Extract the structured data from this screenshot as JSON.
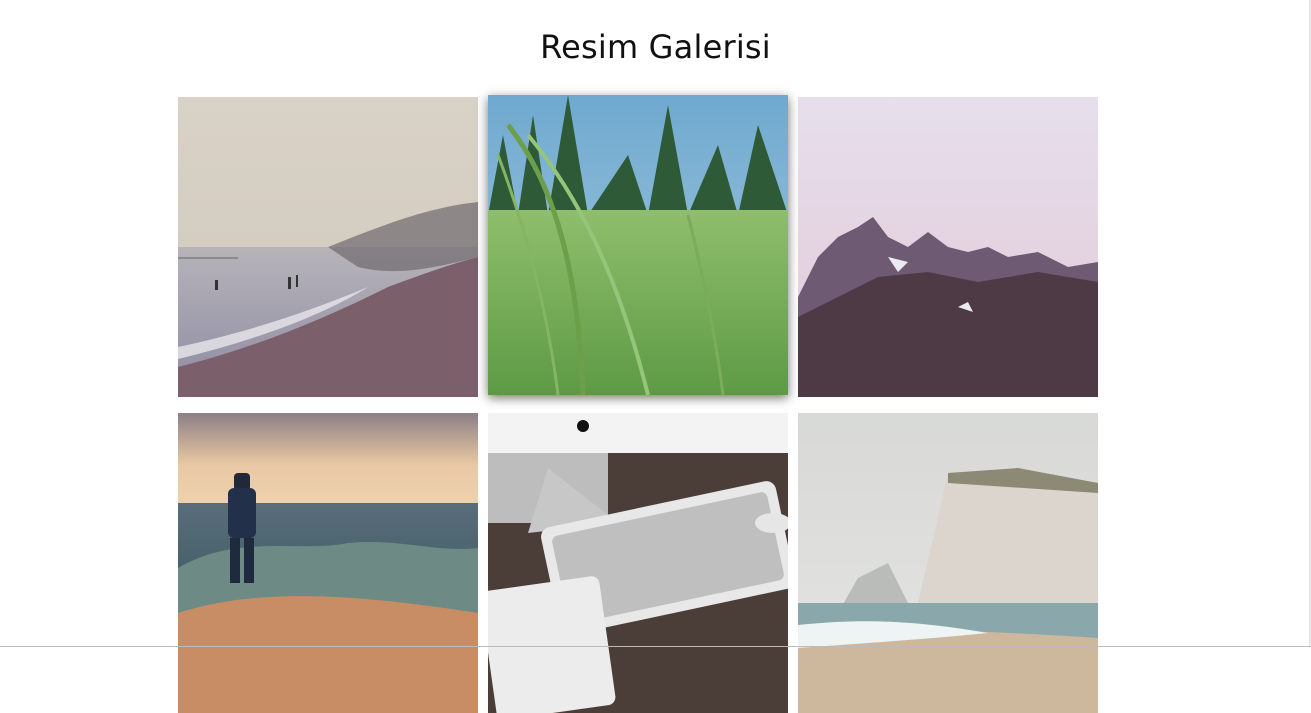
{
  "gallery": {
    "title": "Resim Galerisi",
    "images": [
      {
        "subject": "beach-fog"
      },
      {
        "subject": "grass-field"
      },
      {
        "subject": "mountains"
      },
      {
        "subject": "fisherman"
      },
      {
        "subject": "keyboard-desk"
      },
      {
        "subject": "cliff-coast"
      }
    ]
  }
}
